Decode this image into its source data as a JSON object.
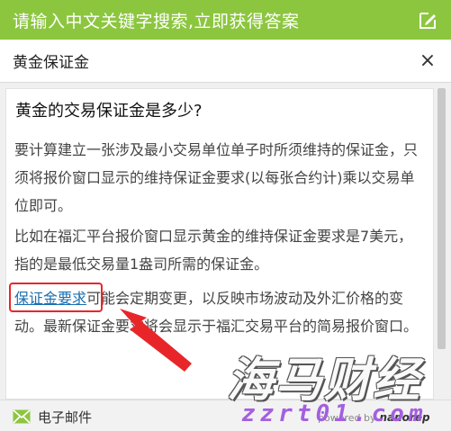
{
  "header": {
    "title": "请输入中文关键字搜索,立即获得答案",
    "edit_icon": "edit-icon"
  },
  "search": {
    "value": "黄金保证金",
    "close_label": "×"
  },
  "article": {
    "question": "黄金的交易保证金是多少?",
    "paragraph1": "要计算建立一张涉及最小交易单位单子时所须维持的保证金，只须将报价窗口显示的维持保证金要求(以每张合约计)乘以交易单位即可。",
    "paragraph2": "比如在福汇平台报价窗口显示黄金的维持保证金要求是7美元，指的是最低交易量1盎司所需的保证金。",
    "paragraph3_link": "保证金要求",
    "paragraph3_rest": "可能会定期变更，以反映市场波动及外汇价格的变动。最新保证金要求将会显示于福汇交易平台的简易报价窗口。"
  },
  "footer": {
    "email_label": "电子邮件",
    "powered_by": "powered by",
    "brand": "nanorep"
  },
  "watermark": {
    "text": "海马财经",
    "url": "zzrt01.com"
  },
  "colors": {
    "header_bg": "#8cc63f",
    "link": "#1a6fb0",
    "annotation": "#e8262a",
    "watermark_url": "#a35fe0"
  }
}
